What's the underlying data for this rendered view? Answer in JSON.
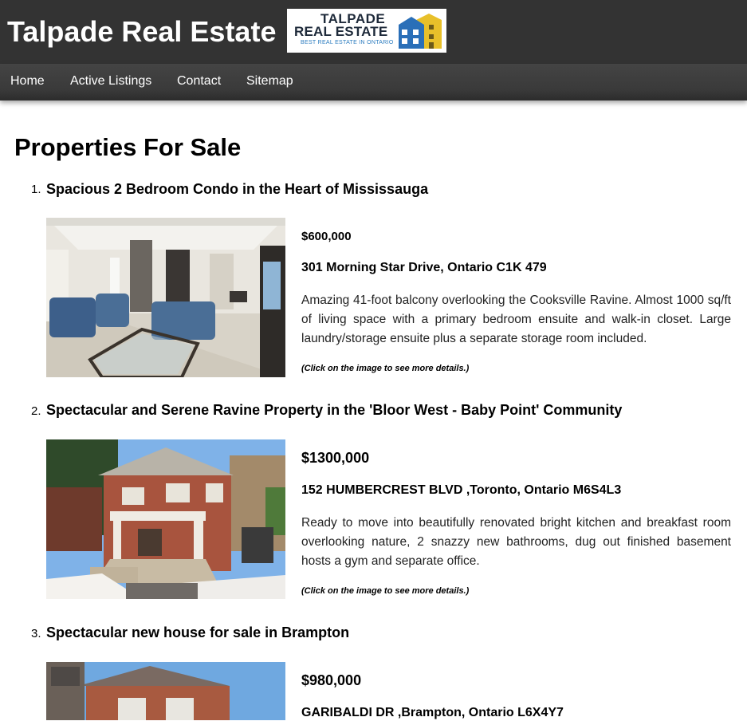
{
  "header": {
    "site_title": "Talpade Real Estate",
    "logo": {
      "line1": "TALPADE",
      "line2": "REAL ESTATE",
      "tagline": "BEST REAL ESTATE IN ONTARIO"
    }
  },
  "nav": {
    "items": [
      "Home",
      "Active Listings",
      "Contact",
      "Sitemap"
    ]
  },
  "main": {
    "heading": "Properties For Sale",
    "listings": [
      {
        "number": "1.",
        "title": "Spacious 2 Bedroom Condo in the Heart of Mississauga",
        "price": "$600,000",
        "address": "301 Morning Star Drive, Ontario C1K 479",
        "description": "Amazing 41-foot balcony overlooking the Cooksville Ravine. Almost 1000 sq/ft of living space with a primary bedroom ensuite and walk-in closet. Large laundry/storage ensuite plus a separate storage room included.",
        "note": "(Click on the image to see more details.)"
      },
      {
        "number": "2.",
        "title": "Spectacular and Serene Ravine Property in the 'Bloor West - Baby Point' Community",
        "price": "$1300,000",
        "address": "152 HUMBERCREST BLVD ,Toronto, Ontario M6S4L3",
        "description": "Ready to move into beautifully renovated bright kitchen and breakfast room overlooking nature, 2 snazzy new bathrooms, dug out finished basement hosts a gym and separate office.",
        "note": "(Click on the image to see more details.)"
      },
      {
        "number": "3.",
        "title": "Spectacular new house for sale in Brampton",
        "price": "$980,000",
        "address": "GARIBALDI DR ,Brampton, Ontario L6X4Y7"
      }
    ]
  },
  "colors": {
    "header_bg": "#333333",
    "nav_bg": "#3a3a3a"
  }
}
